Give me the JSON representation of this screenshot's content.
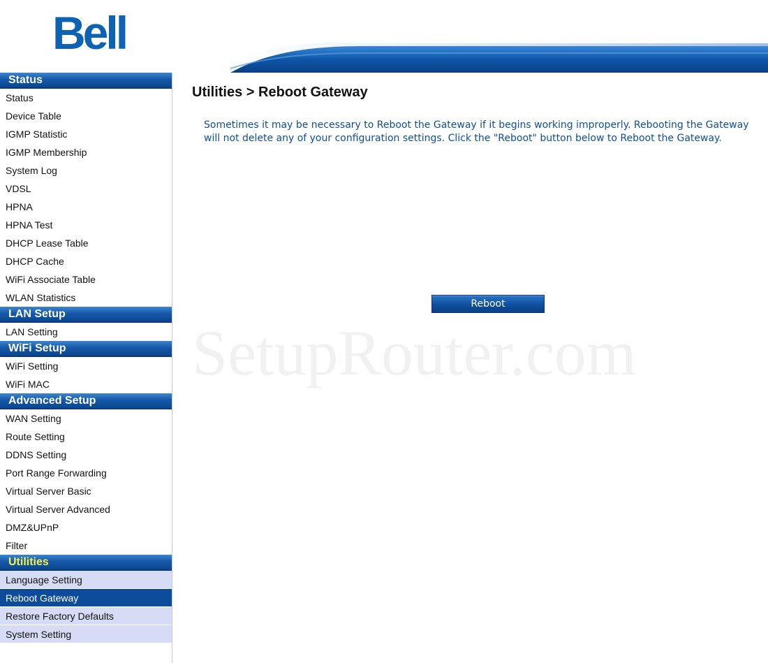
{
  "brand": {
    "logo_text": "Bell"
  },
  "sidebar": {
    "sections": [
      {
        "title": "Status",
        "items": [
          "Status",
          "Device Table",
          "IGMP Statistic",
          "IGMP Membership",
          "System Log",
          "VDSL",
          "HPNA",
          "HPNA Test",
          "DHCP Lease Table",
          "DHCP Cache",
          "WiFi Associate Table",
          "WLAN Statistics"
        ]
      },
      {
        "title": "LAN Setup",
        "items": [
          "LAN Setting"
        ]
      },
      {
        "title": "WiFi Setup",
        "items": [
          "WiFi Setting",
          "WiFi MAC"
        ]
      },
      {
        "title": "Advanced Setup",
        "items": [
          "WAN Setting",
          "Route Setting",
          "DDNS Setting",
          "Port Range Forwarding",
          "Virtual Server Basic",
          "Virtual Server Advanced",
          "DMZ&UPnP",
          "Filter"
        ]
      },
      {
        "title": "Utilities",
        "items": [
          "Language Setting",
          "Reboot Gateway",
          "Restore Factory Defaults",
          "System Setting"
        ],
        "active": true,
        "selected_item": "Reboot Gateway"
      }
    ]
  },
  "main": {
    "title": "Utilities > Reboot Gateway",
    "description": "Sometimes it may be necessary to Reboot the Gateway if it begins working improperly. Rebooting the Gateway will not delete any of your configuration settings. Click the \"Reboot\" button below to Reboot the Gateway.",
    "reboot_button": "Reboot"
  },
  "watermark": "SetupRouter.com",
  "colors": {
    "brand_blue": "#0d62b4",
    "nav_header": "#1659a8",
    "active_header_text": "#f3f34a",
    "selected_item": "#0d4c9b",
    "utilities_item_bg": "#d6dcf5",
    "description_text": "#0d4f9c"
  },
  "icons": {
    "header_graphic": "blue-swoosh-banner"
  }
}
